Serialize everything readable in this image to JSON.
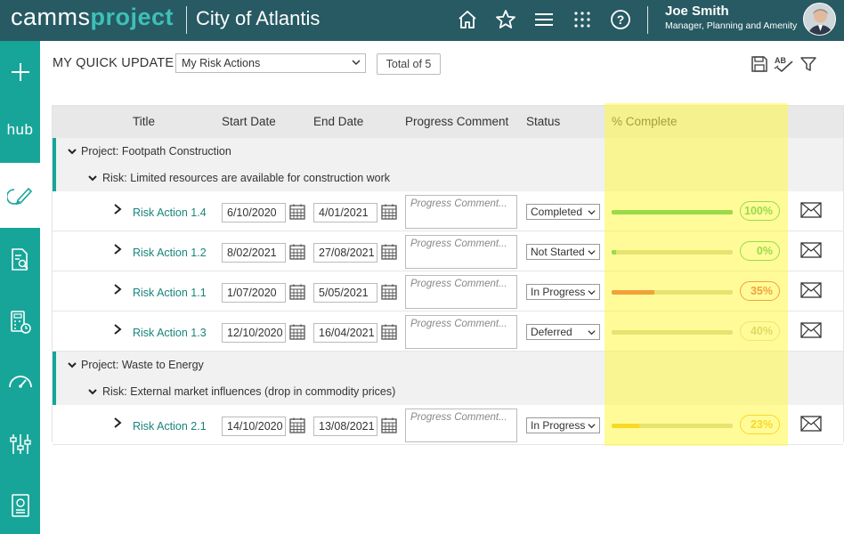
{
  "app": {
    "logo_light": "camms",
    "logo_bold": "project",
    "title": "City of Atlantis"
  },
  "user": {
    "name": "Joe Smith",
    "role": "Manager, Planning and Amenity"
  },
  "topnav_icons": [
    "home-icon",
    "star-icon",
    "menu-icon",
    "apps-grid-icon",
    "help-icon"
  ],
  "sidebar": {
    "items": [
      "add-icon",
      "hub-icon",
      "quick-update-icon",
      "report-search-icon",
      "calculator-clock-icon",
      "dashboard-gauge-icon",
      "filters-icon",
      "document-icon"
    ],
    "hub_label": "hub"
  },
  "header": {
    "page_title": "MY QUICK UPDATE",
    "filter_value": "My Risk Actions",
    "total_label": "Total of 5",
    "tools": [
      "save-icon",
      "spellcheck-icon",
      "filter-icon"
    ]
  },
  "table": {
    "columns": [
      "Title",
      "Start Date",
      "End Date",
      "Progress Comment",
      "Status",
      "% Complete"
    ],
    "comment_placeholder": "Progress Comment...",
    "groups": [
      {
        "project": "Project: Footpath Construction",
        "risk": "Risk: Limited resources are available for construction work",
        "rows": [
          {
            "title": "Risk Action 1.4",
            "start": "6/10/2020",
            "end": "4/01/2021",
            "status": "Completed",
            "percent": 100,
            "percent_label": "100%",
            "color": "#1db84a"
          },
          {
            "title": "Risk Action 1.2",
            "start": "8/02/2021",
            "end": "27/08/2021",
            "status": "Not Started",
            "percent": 0,
            "percent_label": "0%",
            "color": "#1db84a"
          },
          {
            "title": "Risk Action 1.1",
            "start": "1/07/2020",
            "end": "5/05/2021",
            "status": "In Progress",
            "percent": 35,
            "percent_label": "35%",
            "color": "#e03a2a"
          },
          {
            "title": "Risk Action 1.3",
            "start": "12/10/2020",
            "end": "16/04/2021",
            "status": "Deferred",
            "percent": 40,
            "percent_label": "40%",
            "color": "#c9c9a4"
          }
        ]
      },
      {
        "project": "Project: Waste to Energy",
        "risk": "Risk: External market influences (drop in commodity prices)",
        "rows": [
          {
            "title": "Risk Action 2.1",
            "start": "14/10/2020",
            "end": "13/08/2021",
            "status": "In Progress",
            "percent": 23,
            "percent_label": "23%",
            "color": "#f0b400"
          }
        ]
      }
    ]
  }
}
